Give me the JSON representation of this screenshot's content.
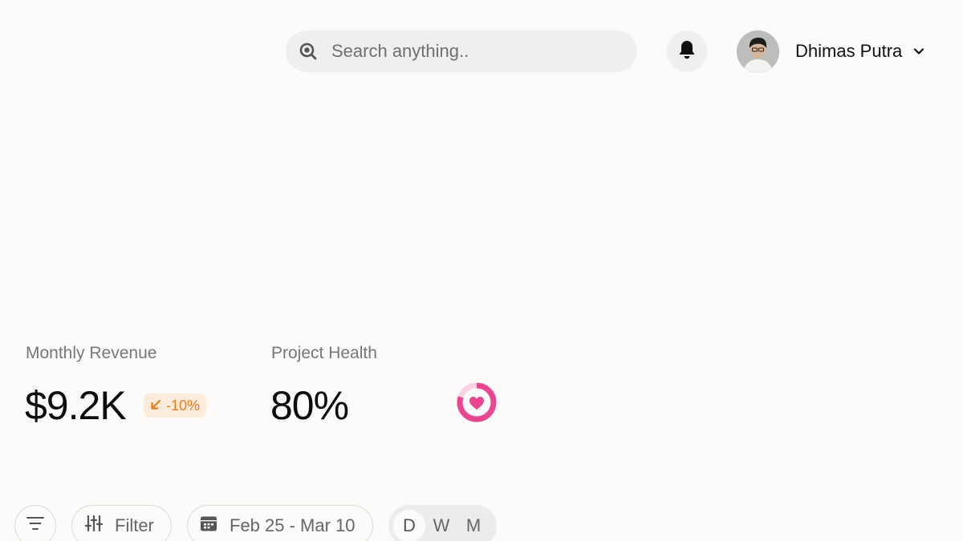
{
  "header": {
    "search": {
      "placeholder": "Search anything..",
      "icon": "search-icon"
    },
    "notifications": {
      "icon": "bell-icon"
    },
    "user": {
      "name": "Dhimas Putra",
      "dropdown_icon": "chevron-down-icon"
    }
  },
  "stats": {
    "revenue": {
      "label": "Monthly Revenue",
      "value": "$9.2K",
      "change": "-10%",
      "change_icon": "arrow-down-left-icon",
      "change_color": "#f07a1a"
    },
    "health": {
      "label": "Project Health",
      "value": "80%",
      "progress": 0.8,
      "icon": "heart-icon",
      "accent_color": "#e94591"
    }
  },
  "toolbar": {
    "sort_icon": "sort-lines-icon",
    "filter_label": "Filter",
    "filter_icon": "sliders-icon",
    "date_range": "Feb 25 - Mar 10",
    "date_icon": "calendar-icon",
    "period": {
      "options": [
        "D",
        "W",
        "M"
      ],
      "selected": "D"
    }
  }
}
